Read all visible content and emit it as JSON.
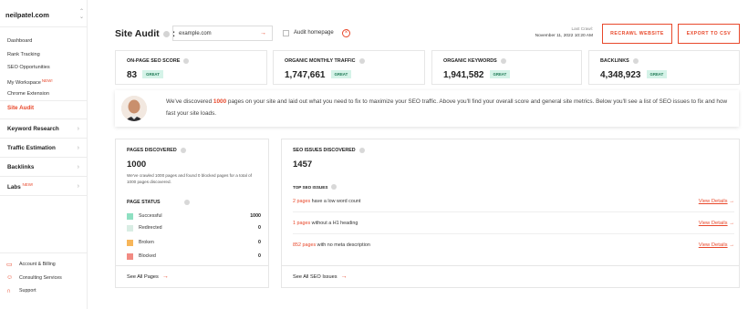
{
  "sidebar": {
    "site": "neilpatel.com",
    "menu": [
      {
        "label": "Dashboard"
      },
      {
        "label": "Rank Tracking"
      },
      {
        "label": "SEO Opportunities"
      },
      {
        "label": "My Workspace",
        "badge": "NEW!"
      },
      {
        "label": "Chrome Extension"
      }
    ],
    "active": "Site Audit",
    "sections": [
      {
        "label": "Keyword Research"
      },
      {
        "label": "Traffic Estimation"
      },
      {
        "label": "Backlinks"
      },
      {
        "label": "Labs",
        "badge": "NEW!"
      }
    ],
    "bottom": [
      {
        "label": "Account & Billing",
        "icon": "card-icon"
      },
      {
        "label": "Consulting Services",
        "icon": "people-icon"
      },
      {
        "label": "Support",
        "icon": "headset-icon"
      }
    ]
  },
  "header": {
    "title": "Site Audit",
    "url_value": "example.com",
    "audit_homepage_label": "Audit homepage",
    "last_crawl_label": "Last Crawl:",
    "last_crawl_date": "November 11, 2022 10:20 AM",
    "recrawl_label": "RECRAWL WEBSITE",
    "export_label": "EXPORT TO CSV"
  },
  "metrics": [
    {
      "label": "ON-PAGE SEO SCORE",
      "value": "83",
      "badge": "GREAT"
    },
    {
      "label": "ORGANIC MONTHLY TRAFFIC",
      "value": "1,747,661",
      "badge": "GREAT"
    },
    {
      "label": "ORGANIC KEYWORDS",
      "value": "1,941,582",
      "badge": "GREAT"
    },
    {
      "label": "BACKLINKS",
      "value": "4,348,923",
      "badge": "GREAT"
    }
  ],
  "intro": {
    "pre": "We've discovered ",
    "highlight": "1000",
    "post": " pages on your site and laid out what you need to fix to maximize your SEO traffic. Above you'll find your overall score and general site metrics. Below you'll see a list of SEO issues to fix and how fast your site loads."
  },
  "pages": {
    "label": "PAGES DISCOVERED",
    "value": "1000",
    "note": "We've crawled 1000 pages and found 0 blocked pages for a total of 1000 pages discovered.",
    "status_label": "PAGE STATUS",
    "statuses": [
      {
        "name": "Successful",
        "count": "1000",
        "color": "#8fe0c2"
      },
      {
        "name": "Redirected",
        "count": "0",
        "color": "#d9ede4"
      },
      {
        "name": "Broken",
        "count": "0",
        "color": "#f7b65a"
      },
      {
        "name": "Blocked",
        "count": "0",
        "color": "#f28b83"
      }
    ],
    "footer": "See All Pages"
  },
  "issues": {
    "label": "SEO ISSUES DISCOVERED",
    "value": "1457",
    "top_label": "TOP SEO ISSUES",
    "items": [
      {
        "count": "2 pages",
        "text": " have a low word count",
        "action": "View Details"
      },
      {
        "count": "1 pages",
        "text": " without a H1 heading",
        "action": "View Details"
      },
      {
        "count": "852 pages",
        "text": " with no meta description",
        "action": "View Details"
      }
    ],
    "footer": "See All SEO Issues"
  }
}
